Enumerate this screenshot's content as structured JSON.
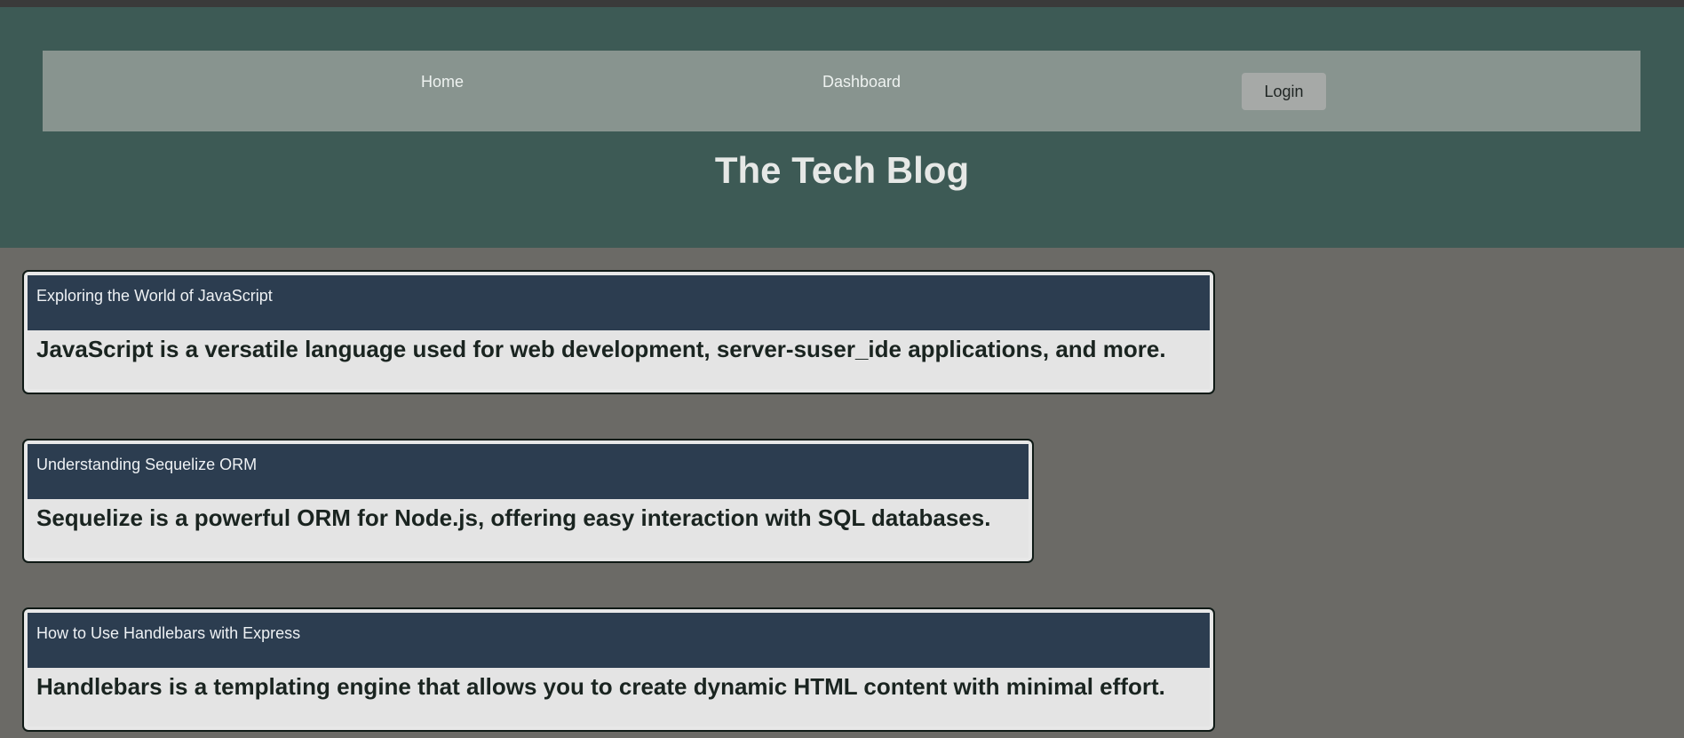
{
  "nav": {
    "home_label": "Home",
    "dashboard_label": "Dashboard",
    "login_label": "Login"
  },
  "header": {
    "title": "The Tech Blog"
  },
  "posts": [
    {
      "title": "Exploring the World of JavaScript",
      "content": "JavaScript is a versatile language used for web development, server-suser_ide applications, and more."
    },
    {
      "title": "Understanding Sequelize ORM",
      "content": "Sequelize is a powerful ORM for Node.js, offering easy interaction with SQL databases."
    },
    {
      "title": "How to Use Handlebars with Express",
      "content": "Handlebars is a templating engine that allows you to create dynamic HTML content with minimal effort."
    }
  ],
  "colors": {
    "header_bg": "#3d5a55",
    "nav_bg": "#88948f",
    "page_bg": "#6b6a66",
    "post_header_bg": "#2c3d50",
    "post_body_bg": "#e4e4e4"
  }
}
